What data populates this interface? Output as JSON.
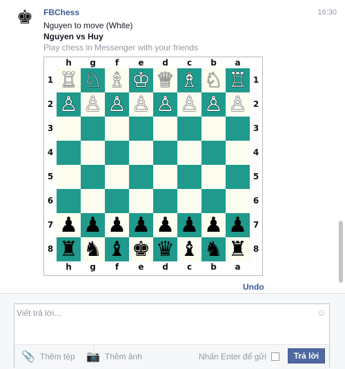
{
  "message": {
    "avatar_glyph": "♚",
    "sender": "FBChess",
    "time": "16:30",
    "status_line": "Nguyen to move (White)",
    "players_line": "Nguyen vs Huy",
    "tagline": "Play chess in Messenger with your friends"
  },
  "board": {
    "files": [
      "h",
      "g",
      "f",
      "e",
      "d",
      "c",
      "b",
      "a"
    ],
    "ranks": [
      "1",
      "2",
      "3",
      "4",
      "5",
      "6",
      "7",
      "8"
    ],
    "rows": [
      [
        "♖",
        "♘",
        "♗",
        "♔",
        "♕",
        "♗",
        "♘",
        "♖"
      ],
      [
        "♙",
        "♙",
        "♙",
        "♙",
        "♙",
        "♙",
        "♙",
        "♙"
      ],
      [
        "",
        "",
        "",
        "",
        "",
        "",
        "",
        ""
      ],
      [
        "",
        "",
        "",
        "",
        "",
        "",
        "",
        ""
      ],
      [
        "",
        "",
        "",
        "",
        "",
        "",
        "",
        ""
      ],
      [
        "",
        "",
        "",
        "",
        "",
        "",
        "",
        ""
      ],
      [
        "♟",
        "♟",
        "♟",
        "♟",
        "♟",
        "♟",
        "♟",
        "♟"
      ],
      [
        "♜",
        "♞",
        "♝",
        "♚",
        "♛",
        "♝",
        "♞",
        "♜"
      ]
    ],
    "colors": {
      "light": "#fdfdf0",
      "dark": "#1f9a8c"
    }
  },
  "undo_label": "Undo",
  "composer": {
    "placeholder": "Viết trả lời...",
    "add_file_label": "Thêm tệp",
    "add_photo_label": "Thêm ảnh",
    "enter_to_send_label": "Nhấn Enter để gửi",
    "reply_button_label": "Trả lời"
  }
}
